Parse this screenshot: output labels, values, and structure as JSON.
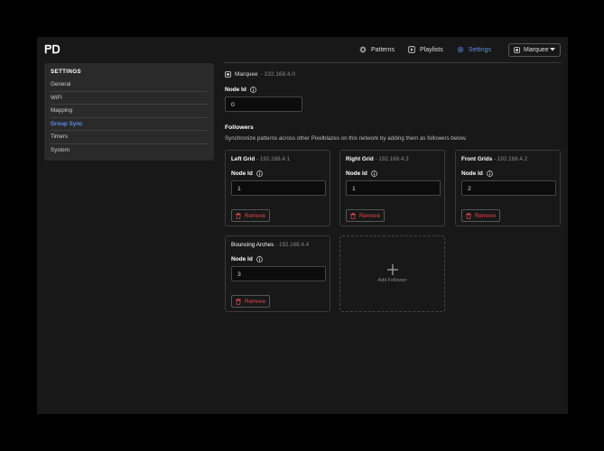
{
  "nav": {
    "patterns_label": "Patterns",
    "playlists_label": "Playlists",
    "settings_label": "Settings",
    "device_select_value": "Marquee",
    "active_color": "#5b8def"
  },
  "sidebar": {
    "title": "SETTINGS",
    "items": [
      {
        "label": "General"
      },
      {
        "label": "WiFi"
      },
      {
        "label": "Mapping"
      },
      {
        "label": "Group Sync"
      },
      {
        "label": "Timers"
      },
      {
        "label": "System"
      }
    ]
  },
  "main": {
    "leader_name": "Marquee",
    "leader_ip": "- 192.168.4.0",
    "node_id_label": "Node Id",
    "leader_node_id": "0",
    "followers_title": "Followers",
    "followers_desc": "Synchronize patterns across other Pixelblazes on this network by adding them as followers below.",
    "followers": [
      {
        "name": "Left Grid",
        "ip": " - 192.168.4.1",
        "node_label": "Node Id",
        "node_id": "1",
        "remove_label": "Remove"
      },
      {
        "name": "Right Grid",
        "ip": " - 192.168.4.3",
        "node_label": "Node Id",
        "node_id": "1",
        "remove_label": "Remove"
      },
      {
        "name": "Front Grids",
        "ip": " - 192.168.4.2",
        "node_label": "Node Id",
        "node_id": "2",
        "remove_label": "Remove"
      },
      {
        "name": "Bouncing Arches",
        "ip": " - 192.168.4.4",
        "node_label": "Node Id",
        "node_id": "3",
        "remove_label": "Remove"
      }
    ],
    "add_follower_label": "Add Follower",
    "remove_color": "#e5484d"
  }
}
